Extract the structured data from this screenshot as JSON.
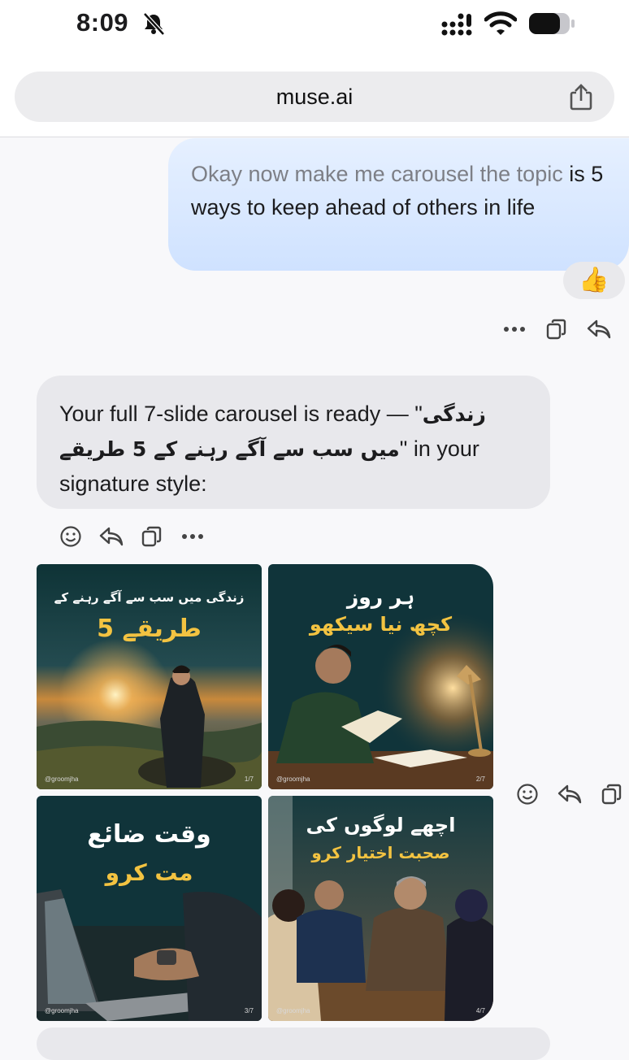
{
  "status": {
    "time": "8:09"
  },
  "browser": {
    "url": "muse.ai"
  },
  "chat": {
    "user_message": {
      "dim_text": "Okay now make me carousel the topic",
      "text": "is 5 ways to keep ahead of others in life",
      "reaction": "👍"
    },
    "assistant_message": {
      "part1": "Your full 7-slide carousel is ready — \"",
      "urdu_title": "زندگی میں سب سے آگے رہنے کے 5 طریقے",
      "part2": "\" in your signature style:"
    },
    "slides": [
      {
        "line1": "زندگی میں سب سے آگے رہنے کے",
        "line2": "5 طریقے",
        "handle": "@groomjha",
        "page": "1/7"
      },
      {
        "line1": "ہر روز",
        "line2": "کچھ نیا سیکھو",
        "handle": "@groomjha",
        "page": "2/7"
      },
      {
        "line1": "وقت ضائع",
        "line2": "مت کرو",
        "handle": "@groomjha",
        "page": "3/7"
      },
      {
        "line1": "اچھے لوگوں کی",
        "line2": "صحبت اختیار کرو",
        "handle": "@groomjha",
        "page": "4/7"
      }
    ]
  },
  "colors": {
    "user_bubble": "#d8e8ff",
    "ai_bubble": "#e8e8ec",
    "slide_bg": "#10343a",
    "accent_yellow": "#f3c341"
  }
}
